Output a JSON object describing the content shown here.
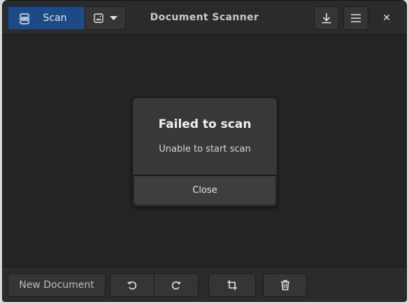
{
  "header": {
    "title": "Document Scanner",
    "scan_label": "Scan",
    "icons": {
      "scan": "scanner-icon",
      "source": "image-icon",
      "dropdown": "chevron-down-icon",
      "save": "download-icon",
      "menu": "hamburger-menu-icon",
      "close": "close-icon"
    },
    "close_glyph": "✕"
  },
  "dialog": {
    "title": "Failed to scan",
    "message": "Unable to start scan",
    "close_label": "Close"
  },
  "footer": {
    "new_document_label": "New Document",
    "icons": {
      "rotate_left": "rotate-left-icon",
      "rotate_right": "rotate-right-icon",
      "crop": "crop-icon",
      "delete": "trash-icon"
    }
  },
  "colors": {
    "accent": "#1d4a85",
    "background": "#242424",
    "headerbar": "#2b2b2b",
    "dialog": "#383838"
  }
}
